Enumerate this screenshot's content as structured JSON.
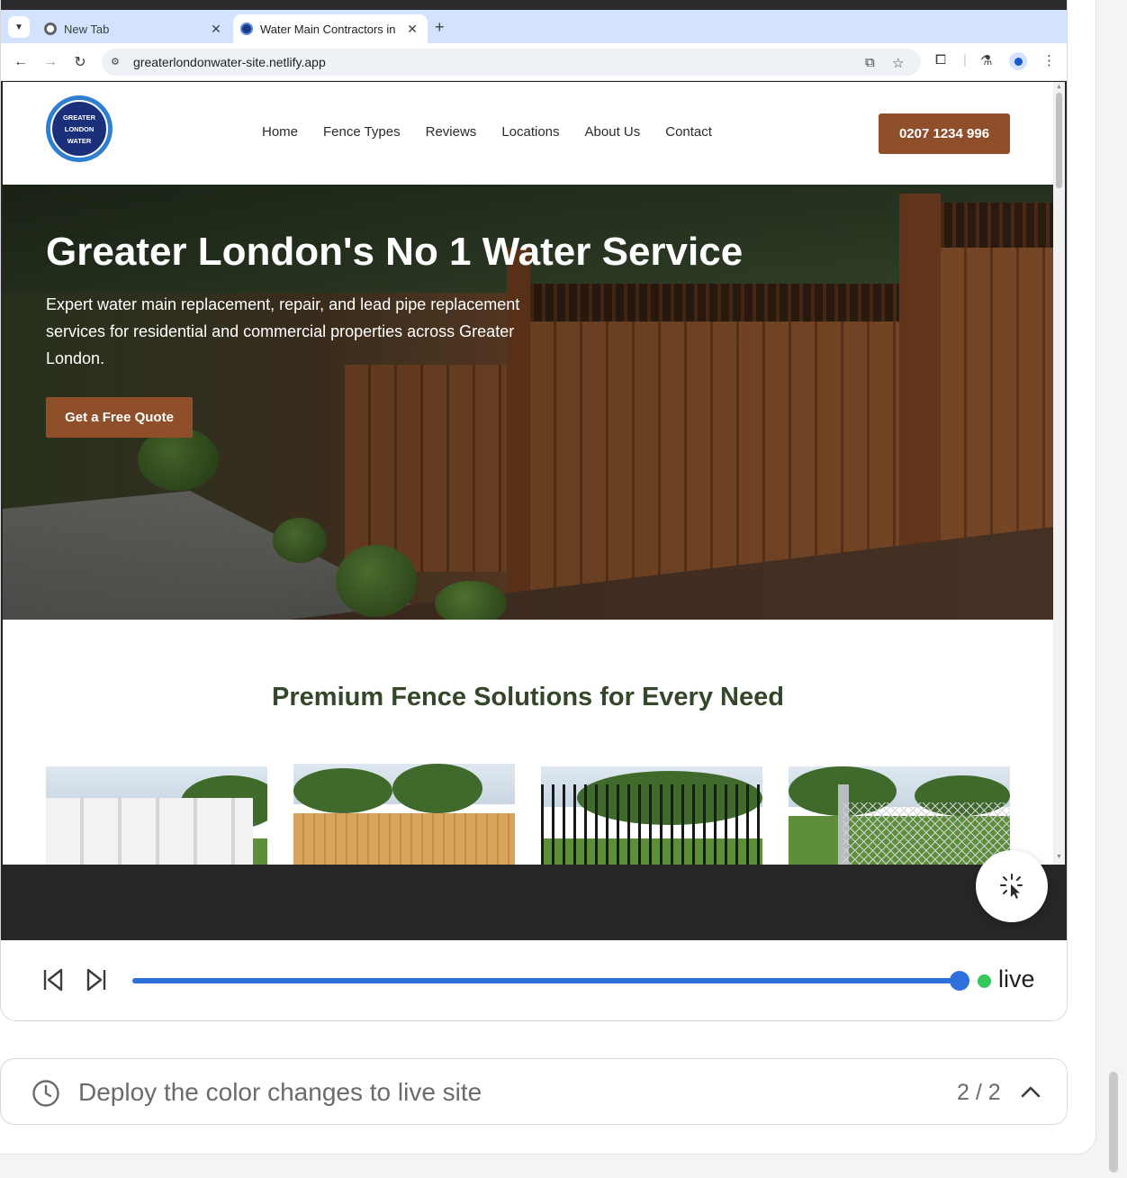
{
  "browser": {
    "tabs": [
      {
        "title": "New Tab",
        "active": false
      },
      {
        "title": "Water Main Contractors in",
        "active": true
      }
    ],
    "url": "greaterlondonwater-site.netlify.app"
  },
  "site": {
    "logo": {
      "line1": "GREATER",
      "line2": "LONDON",
      "line3": "WATER"
    },
    "nav": [
      "Home",
      "Fence Types",
      "Reviews",
      "Locations",
      "About Us",
      "Contact"
    ],
    "phone": "0207 1234 996",
    "hero": {
      "title": "Greater London's No 1 Water Service",
      "subtitle": "Expert water main replacement, repair, and lead pipe replacement services for residential and commercial properties across Greater London.",
      "cta": "Get a Free Quote"
    },
    "section_title": "Premium Fence Solutions for Every Need",
    "fence_cards": [
      "white-vinyl-fence-image",
      "wood-privacy-fence-image",
      "black-metal-fence-image",
      "chain-link-fence-image"
    ]
  },
  "player": {
    "progress": 1.0,
    "live_label": "live"
  },
  "task": {
    "text": "Deploy the color changes to live site",
    "counter": "2 / 2"
  },
  "colors": {
    "brand_brown": "#8f4f2b",
    "section_green": "#35472a",
    "progress_blue": "#2f6fdc",
    "live_green": "#34c759"
  }
}
